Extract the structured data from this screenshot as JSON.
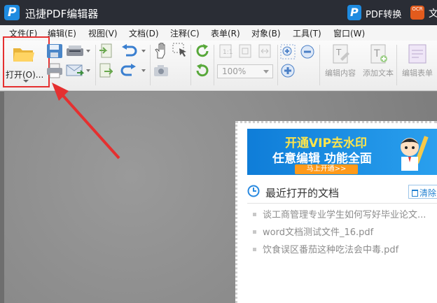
{
  "app": {
    "title": "迅捷PDF编辑器",
    "logo_letter": "P"
  },
  "titlebar": {
    "convert_label": "PDF转换",
    "convert_logo_letter": "P",
    "ocr_label": "OCR",
    "trail_char": "文"
  },
  "menu": [
    {
      "label": "文件(F)"
    },
    {
      "label": "编辑(E)"
    },
    {
      "label": "视图(V)"
    },
    {
      "label": "文档(D)"
    },
    {
      "label": "注释(C)"
    },
    {
      "label": "表单(R)"
    },
    {
      "label": "对象(B)"
    },
    {
      "label": "工具(T)"
    },
    {
      "label": "窗口(W)"
    }
  ],
  "toolbar": {
    "open_label": "打开(O)...",
    "zoom_value": "100%",
    "edit_content_label": "编辑内容",
    "add_text_label": "添加文本",
    "edit_form_label": "编辑表单"
  },
  "start_panel": {
    "vip_line1": "开通VIP去水印",
    "vip_line2": "任意编辑  功能全面",
    "vip_button": "马上开通>>",
    "recent_title": "最近打开的文档",
    "clear_label": "清除",
    "recent_files": [
      "谈工商管理专业学生如何写好毕业论文...",
      "word文档测试文件_16.pdf",
      "饮食误区番茄这种吃法会中毒.pdf"
    ]
  },
  "colors": {
    "accent": "#1e8be0",
    "highlight": "#e53030",
    "titlebar": "#2a2d35",
    "vip_orange": "#ff9a1a"
  }
}
